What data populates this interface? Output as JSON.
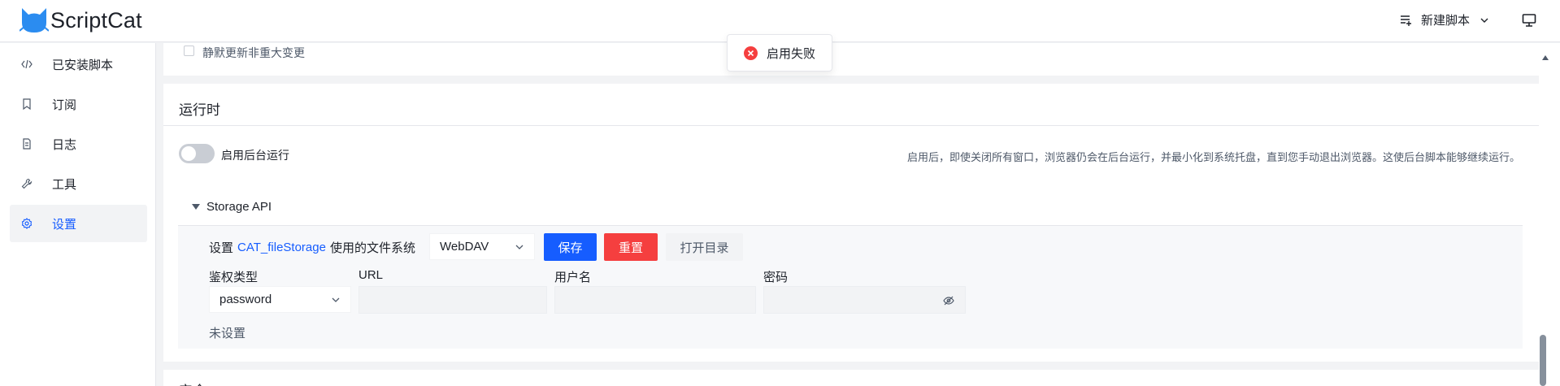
{
  "header": {
    "app_name": "ScriptCat",
    "new_script_label": "新建脚本"
  },
  "sidebar": {
    "items": [
      {
        "label": "已安装脚本",
        "icon": "code-icon"
      },
      {
        "label": "订阅",
        "icon": "bookmark-icon"
      },
      {
        "label": "日志",
        "icon": "file-icon"
      },
      {
        "label": "工具",
        "icon": "wrench-icon"
      },
      {
        "label": "设置",
        "icon": "gear-icon",
        "active": true
      }
    ]
  },
  "main": {
    "top_partial_text": "静默更新非重大变更",
    "runtime": {
      "title": "运行时",
      "background_run": {
        "label": "启用后台运行",
        "enabled": false,
        "description": "启用后，即使关闭所有窗口，浏览器仍会在后台运行，并最小化到系统托盘，直到您手动退出浏览器。这使后台脚本能够继续运行。"
      },
      "storage_api": {
        "title": "Storage API",
        "set_prefix": "设置",
        "link_text": "CAT_fileStorage",
        "set_suffix": "使用的文件系统",
        "filesystem": "WebDAV",
        "save_label": "保存",
        "reset_label": "重置",
        "open_dir_label": "打开目录",
        "auth_type_label": "鉴权类型",
        "auth_type_value": "password",
        "url_label": "URL",
        "url_value": "",
        "username_label": "用户名",
        "username_value": "",
        "password_label": "密码",
        "password_value": "",
        "status": "未设置"
      }
    },
    "next_section_partial": "安全"
  },
  "toast": {
    "message": "启用失败"
  },
  "colors": {
    "primary": "#165dff",
    "danger": "#f53f3f",
    "logo": "#2b8cf0"
  }
}
